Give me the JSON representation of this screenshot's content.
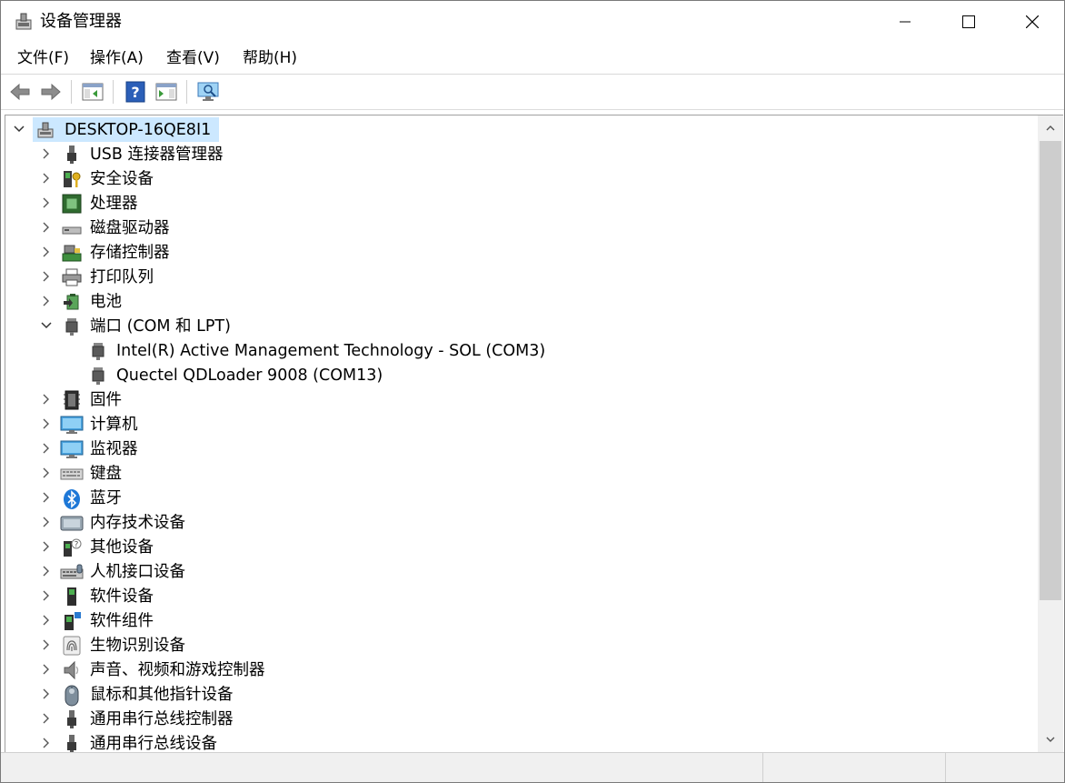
{
  "window": {
    "title": "设备管理器"
  },
  "menu": [
    {
      "name": "menu-file",
      "label": "文件(F)"
    },
    {
      "name": "menu-action",
      "label": "操作(A)"
    },
    {
      "name": "menu-view",
      "label": "查看(V)"
    },
    {
      "name": "menu-help",
      "label": "帮助(H)"
    }
  ],
  "toolbar": [
    {
      "name": "back-button",
      "icon": "back-arrow-icon"
    },
    {
      "name": "forward-button",
      "icon": "forward-arrow-icon"
    },
    {
      "name": "show-hide-console-tree-button",
      "icon": "console-tree-icon"
    },
    {
      "name": "help-button",
      "icon": "help-icon"
    },
    {
      "name": "show-hide-action-pane-button",
      "icon": "action-pane-icon"
    },
    {
      "name": "scan-hardware-button",
      "icon": "monitor-scan-icon"
    }
  ],
  "tree": {
    "root": {
      "label": "DESKTOP-16QE8I1",
      "icon": "computer-icon",
      "expanded": true,
      "selected": true
    },
    "categories": [
      {
        "label": "USB 连接器管理器",
        "icon": "usb-connector-icon",
        "expanded": false
      },
      {
        "label": "安全设备",
        "icon": "security-key-icon",
        "expanded": false
      },
      {
        "label": "处理器",
        "icon": "processor-icon",
        "expanded": false
      },
      {
        "label": "磁盘驱动器",
        "icon": "disk-drive-icon",
        "expanded": false
      },
      {
        "label": "存储控制器",
        "icon": "storage-controller-icon",
        "expanded": false
      },
      {
        "label": "打印队列",
        "icon": "printer-icon",
        "expanded": false
      },
      {
        "label": "电池",
        "icon": "battery-icon",
        "expanded": false
      },
      {
        "label": "端口 (COM 和 LPT)",
        "icon": "port-icon",
        "expanded": true,
        "children": [
          {
            "label": "Intel(R) Active Management Technology - SOL (COM3)",
            "icon": "port-icon"
          },
          {
            "label": "Quectel QDLoader 9008 (COM13)",
            "icon": "port-icon"
          }
        ]
      },
      {
        "label": "固件",
        "icon": "firmware-icon",
        "expanded": false
      },
      {
        "label": "计算机",
        "icon": "computer-monitor-icon",
        "expanded": false
      },
      {
        "label": "监视器",
        "icon": "monitor-icon",
        "expanded": false
      },
      {
        "label": "键盘",
        "icon": "keyboard-icon",
        "expanded": false
      },
      {
        "label": "蓝牙",
        "icon": "bluetooth-icon",
        "expanded": false
      },
      {
        "label": "内存技术设备",
        "icon": "memory-device-icon",
        "expanded": false
      },
      {
        "label": "其他设备",
        "icon": "unknown-device-icon",
        "expanded": false
      },
      {
        "label": "人机接口设备",
        "icon": "hid-icon",
        "expanded": false
      },
      {
        "label": "软件设备",
        "icon": "software-device-icon",
        "expanded": false
      },
      {
        "label": "软件组件",
        "icon": "software-component-icon",
        "expanded": false
      },
      {
        "label": "生物识别设备",
        "icon": "fingerprint-icon",
        "expanded": false
      },
      {
        "label": "声音、视频和游戏控制器",
        "icon": "speaker-icon",
        "expanded": false
      },
      {
        "label": "鼠标和其他指针设备",
        "icon": "mouse-icon",
        "expanded": false
      },
      {
        "label": "通用串行总线控制器",
        "icon": "usb-icon",
        "expanded": false
      },
      {
        "label": "通用串行总线设备",
        "icon": "usb-icon",
        "expanded": false
      }
    ]
  },
  "colors": {
    "selection": "#cce8ff",
    "window_border": "#7a7a7a",
    "scrollbar_track": "#f0f0f0",
    "scrollbar_thumb": "#cdcdcd"
  }
}
